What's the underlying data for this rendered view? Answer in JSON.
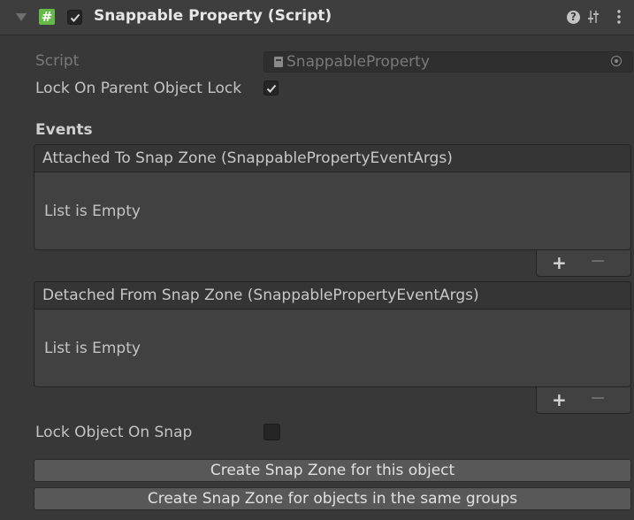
{
  "header": {
    "title": "Snappable Property (Script)",
    "script_glyph": "#",
    "help_glyph": "?",
    "enabled": true
  },
  "script_row": {
    "label": "Script",
    "value": "SnappableProperty"
  },
  "lock_parent": {
    "label": "Lock On Parent Object Lock",
    "checked": true
  },
  "events": {
    "heading": "Events",
    "attached": {
      "title": "Attached To Snap Zone (SnappablePropertyEventArgs)",
      "empty_text": "List is Empty",
      "add_label": "+",
      "remove_label": "−"
    },
    "detached": {
      "title": "Detached From Snap Zone (SnappablePropertyEventArgs)",
      "empty_text": "List is Empty",
      "add_label": "+",
      "remove_label": "−"
    }
  },
  "lock_object": {
    "label": "Lock Object On Snap",
    "checked": false
  },
  "buttons": {
    "create_this": "Create Snap Zone for this object",
    "create_groups": "Create Snap Zone for objects in the same groups"
  },
  "icons": {
    "foldout": "triangle-down-icon",
    "script": "script-hash-icon",
    "help": "help-icon",
    "presets": "sliders-icon",
    "menu": "kebab-menu-icon",
    "file": "script-file-icon",
    "picker": "object-picker-icon",
    "check": "checkmark-icon"
  },
  "colors": {
    "background": "#383838",
    "header": "#3e3e3e",
    "script_icon": "#66b847",
    "button": "#585858"
  }
}
